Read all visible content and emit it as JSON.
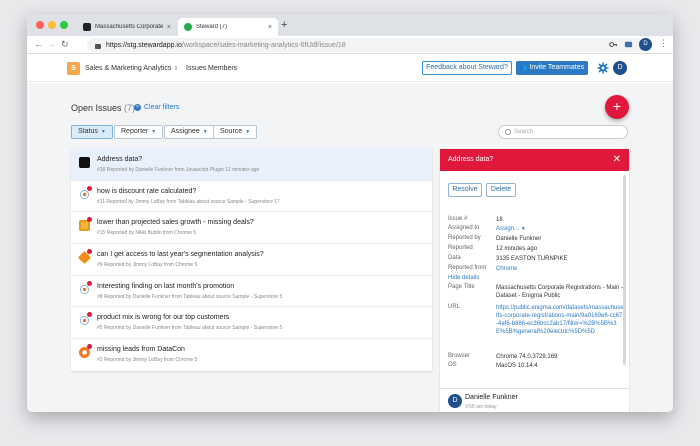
{
  "browser": {
    "tabs": [
      {
        "title": "Massachusetts Corporate Re...",
        "favicon_color": "#222222",
        "active": false
      },
      {
        "title": "Steward (7)",
        "favicon_color": "#2aa84a",
        "active": true
      }
    ],
    "url_host": "https://stg.stewardapp.io",
    "url_path": "/workspace/sales-marketing-analytics-6ftJdf/issue/18",
    "profile_initial": "D"
  },
  "header": {
    "workspace_initial": "S",
    "workspace_name": "Sales & Marketing Analytics",
    "nav": [
      "Issues",
      "Members"
    ],
    "feedback_label": "Feedback about Steward?",
    "invite_label": "Invite Teammates",
    "user_initial": "D"
  },
  "issues_page": {
    "title": "Open Issues",
    "count": "(7)",
    "clear_filters": "Clear filters",
    "filters": [
      {
        "label": "Status",
        "active": true
      },
      {
        "label": "Reporter",
        "active": false
      },
      {
        "label": "Assignee",
        "active": false
      },
      {
        "label": "Source",
        "active": false
      }
    ],
    "search_placeholder": "Search",
    "add_button": "+"
  },
  "issues": [
    {
      "title": "Address data?",
      "meta": "#18 Reported by Danielle Funkner from Javascript Plugin 12 minutes ago",
      "icon": "javascript-plugin-icon",
      "icon_color": "#111111",
      "selected": true
    },
    {
      "title": "how is discount rate calculated?",
      "meta": "#11 Reported by Jimmy LoBay from Tableau about source Sample - Superstore 17",
      "icon": "tableau-icon",
      "icon_color": "#e8762c",
      "selected": false
    },
    {
      "title": "lower than projected sales growth - missing deals?",
      "meta": "#15 Reported by Nikki Bublin from Chrome 5",
      "icon": "chrome-extension-icon",
      "icon_color": "#f1b43a",
      "selected": false
    },
    {
      "title": "can I get access to last year's segmentation analysis?",
      "meta": "#9 Reported by Jimmy LoBay from Chrome 5",
      "icon": "box-icon",
      "icon_color": "#f28e1c",
      "selected": false
    },
    {
      "title": "Interesting finding on last month's promotion",
      "meta": "#8 Reported by Danielle Funkner from Tableau about source Sample - Superstore 5",
      "icon": "tableau-icon",
      "icon_color": "#e8762c",
      "selected": false
    },
    {
      "title": "product mix is wrong for our top customers",
      "meta": "#5 Reported by Danielle Funkner from Tableau about source Sample - Superstore 5",
      "icon": "tableau-icon",
      "icon_color": "#e8762c",
      "selected": false
    },
    {
      "title": "missing leads from DataCon",
      "meta": "#2 Reported by Jimmy LoBay from Chrome 5",
      "icon": "hubspot-icon",
      "icon_color": "#f57722",
      "selected": false
    }
  ],
  "detail": {
    "title": "Address data?",
    "resolve_label": "Resolve",
    "delete_label": "Delete",
    "fields": [
      {
        "key": "Issue #",
        "value": "18"
      },
      {
        "key": "Assigned to",
        "value": "Assign..."
      },
      {
        "key": "Reported by",
        "value": "Danielle Funkner"
      },
      {
        "key": "Reported",
        "value": "12 minutes ago"
      },
      {
        "key": "Data",
        "value": "3135 EASTON TURNPIKE"
      },
      {
        "key": "Reported from",
        "value": "Chrome"
      }
    ],
    "hide_details": "Hide details",
    "page_title_key": "Page Title",
    "page_title_value": "Massachusetts Corporate Registrations - Main - Dataset - Enigma Public",
    "url_key": "URL",
    "url_value": "https://public.enigma.com/datasets/massachusetts-corporate-registrations-main/9a0169e6-cc67-4af6-b886-ec36bcc2ab17/filter=%2B%5B%3E%5B%general%20electric%5D%5D",
    "browser_key": "Browser",
    "browser_value": "Chrome 74.0.3729.169",
    "os_key": "OS",
    "os_value": "MacOS 10.14.4",
    "comment_initial": "D",
    "comment_author": "Danielle Funkner",
    "comment_time": "9:58 am today"
  }
}
